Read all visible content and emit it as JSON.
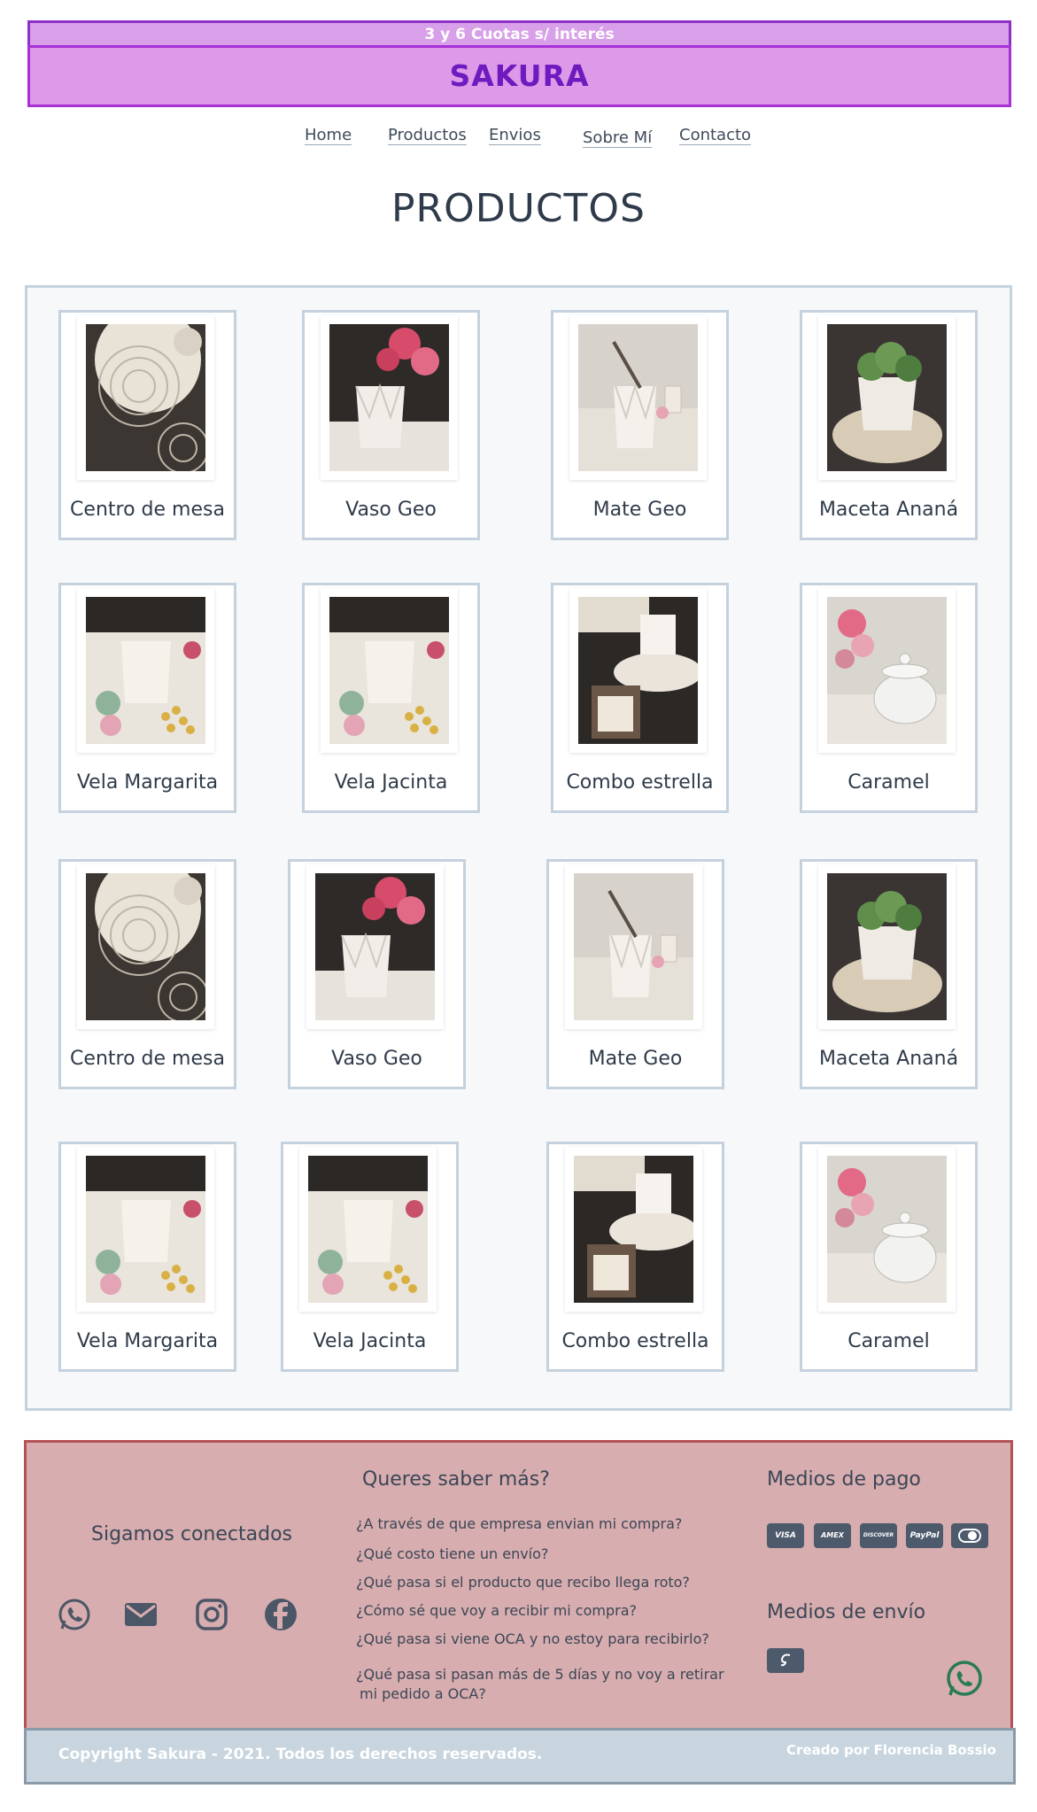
{
  "header": {
    "promo_text": "3 y 6 Cuotas s/ interés",
    "brand": "SAKURA"
  },
  "nav": {
    "home": "Home",
    "productos": "Productos",
    "envios": "Envios",
    "sobre_mi": "Sobre Mí",
    "contacto": "Contacto"
  },
  "page": {
    "title": "PRODUCTOS"
  },
  "products": [
    {
      "label": "Centro de mesa",
      "icon": "doily-photo"
    },
    {
      "label": "Vaso Geo",
      "icon": "geo-cup-flowers-photo"
    },
    {
      "label": "Mate Geo",
      "icon": "mate-photo"
    },
    {
      "label": "Maceta Ananá",
      "icon": "planter-photo"
    },
    {
      "label": "Vela Margarita",
      "icon": "candle-photo"
    },
    {
      "label": "Vela Jacinta",
      "icon": "candle-photo"
    },
    {
      "label": "Combo estrella",
      "icon": "combo-photo"
    },
    {
      "label": "Caramel",
      "icon": "candy-jar-photo"
    },
    {
      "label": "Centro de mesa",
      "icon": "doily-photo"
    },
    {
      "label": "Vaso Geo",
      "icon": "geo-cup-flowers-photo"
    },
    {
      "label": "Mate Geo",
      "icon": "mate-photo"
    },
    {
      "label": "Maceta Ananá",
      "icon": "planter-photo"
    },
    {
      "label": "Vela Margarita",
      "icon": "candle-photo"
    },
    {
      "label": "Vela Jacinta",
      "icon": "candle-photo"
    },
    {
      "label": "Combo estrella",
      "icon": "combo-photo"
    },
    {
      "label": "Caramel",
      "icon": "candy-jar-photo"
    }
  ],
  "footer": {
    "social_title": "Sigamos conectados",
    "faq_title": "Queres saber más?",
    "faq": [
      "¿A través de que empresa envian mi compra?",
      "¿Qué costo tiene un envío?",
      "¿Qué pasa si el producto que recibo llega roto?",
      "¿Cómo sé que voy a recibir mi compra?",
      "¿Qué pasa si viene OCA y no estoy para recibirlo?",
      "¿Qué pasa si pasan más de 5 días y no voy a retirar",
      "mi pedido a OCA?"
    ],
    "payment_title": "Medios de pago",
    "payment_methods": [
      "VISA",
      "AMEX",
      "DISCOVER",
      "PayPal",
      "Mastercard"
    ],
    "shipping_title": "Medios de envío",
    "copyright": "Copyright Sakura - 2021. Todos los derechos reservados.",
    "credit": "Creado por Florencia Bossio"
  },
  "colors": {
    "promo_bg": "#d8a0e8",
    "brand_bg": "#dd9ae8",
    "brand_text": "#6f1abf",
    "panel_border": "#c5d2de",
    "footer_bg": "#d7adaf",
    "footer_border": "#b45257",
    "bottom_bar_bg": "#c8d5df",
    "whatsapp_green": "#2a7a55"
  }
}
